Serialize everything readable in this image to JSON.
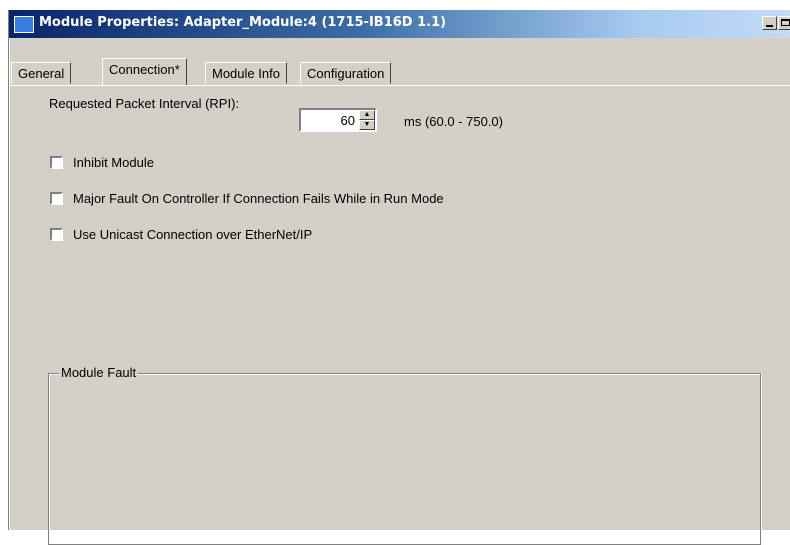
{
  "window": {
    "title": "Module Properties: Adapter_Module:4 (1715-IB16D 1.1)"
  },
  "titlebar_buttons": {
    "minimize_icon": "minimize-icon",
    "maximize_icon": "maximize-icon"
  },
  "tabs": [
    {
      "label": "General",
      "active": false
    },
    {
      "label": "Connection*",
      "active": true
    },
    {
      "label": "Module Info",
      "active": false
    },
    {
      "label": "Configuration",
      "active": false
    }
  ],
  "connection": {
    "rpi_label": "Requested Packet Interval (RPI):",
    "rpi_value": "60",
    "rpi_range": "ms (60.0 - 750.0)",
    "checkboxes": [
      {
        "label": "Inhibit Module",
        "checked": false
      },
      {
        "label": "Major Fault On Controller If Connection Fails While in Run Mode",
        "checked": false
      },
      {
        "label": "Use Unicast Connection over EtherNet/IP",
        "checked": false
      }
    ],
    "module_fault_label": "Module Fault"
  },
  "colors": {
    "title_gradient_start": "#0a246a",
    "title_gradient_end": "#c4dbf5",
    "face": "#d4d0c8"
  }
}
